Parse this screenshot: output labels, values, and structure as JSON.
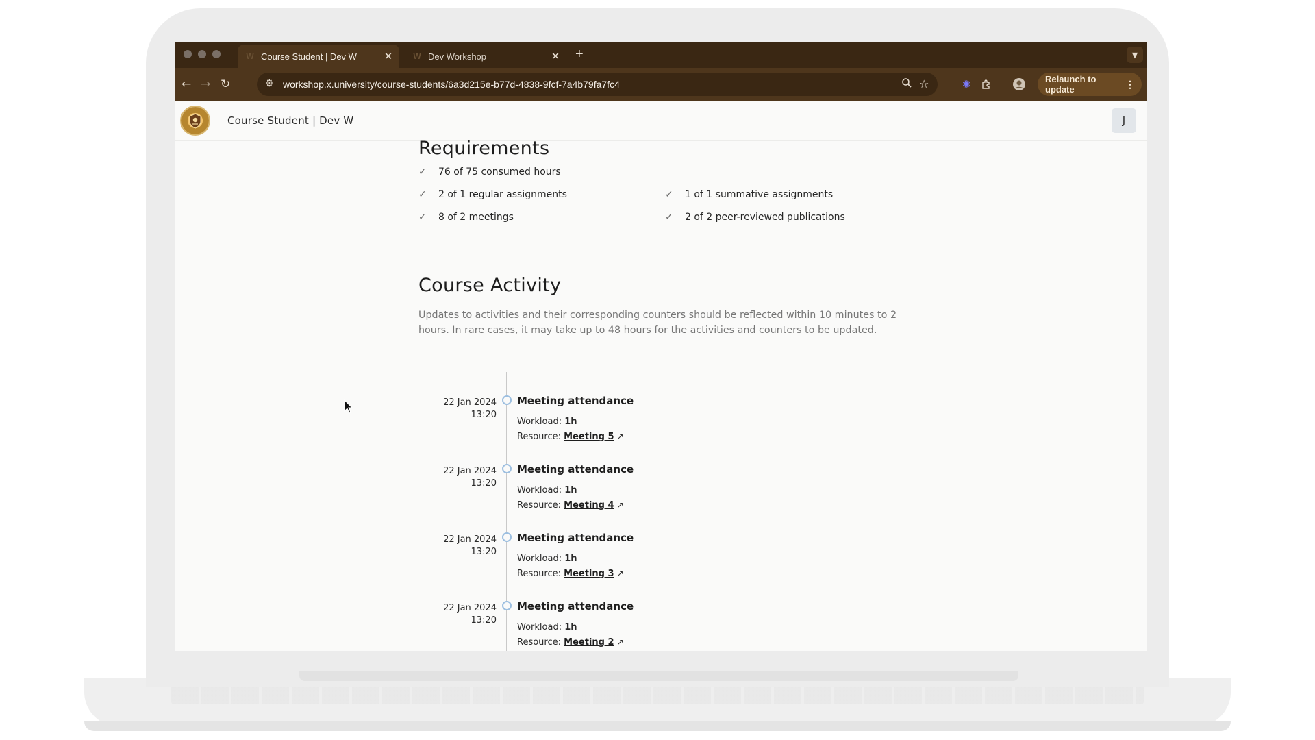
{
  "browser": {
    "tabs": [
      {
        "favicon": "W",
        "title": "Course Student | Dev W",
        "active": true
      },
      {
        "favicon": "W",
        "title": "Dev Workshop",
        "active": false
      }
    ],
    "new_tab_label": "+",
    "url": "workshop.x.university/course-students/6a3d215e-b77d-4838-9fcf-7a4b79fa7fc4",
    "relaunch_label": "Relaunch to update"
  },
  "app": {
    "title": "Course Student | Dev W",
    "avatar_initial": "J"
  },
  "requirements": {
    "title": "Requirements",
    "items": [
      "76 of 75 consumed hours",
      "2 of 1 regular assignments",
      "1 of 1 summative assignments",
      "8 of 2 meetings",
      "2 of 2 peer-reviewed publications"
    ]
  },
  "activity": {
    "title": "Course Activity",
    "description": "Updates to activities and their corresponding counters should be reflected within 10 minutes to 2 hours. In rare cases, it may take up to 48 hours for the activities and counters to be updated.",
    "workload_label": "Workload:",
    "resource_label": "Resource:",
    "entries": [
      {
        "date": "22 Jan 2024",
        "time": "13:20",
        "title": "Meeting attendance",
        "workload": "1h",
        "resource": "Meeting 5"
      },
      {
        "date": "22 Jan 2024",
        "time": "13:20",
        "title": "Meeting attendance",
        "workload": "1h",
        "resource": "Meeting 4"
      },
      {
        "date": "22 Jan 2024",
        "time": "13:20",
        "title": "Meeting attendance",
        "workload": "1h",
        "resource": "Meeting 3"
      },
      {
        "date": "22 Jan 2024",
        "time": "13:20",
        "title": "Meeting attendance",
        "workload": "1h",
        "resource": "Meeting 2"
      }
    ]
  },
  "icons": {
    "back": "arrow-left-icon",
    "forward": "arrow-right-icon",
    "reload": "reload-icon",
    "site_settings": "tune-icon",
    "zoom": "zoom-icon",
    "bookmark": "star-icon",
    "check": "check-icon",
    "external": "external-link-icon"
  },
  "colors": {
    "browser_frame": "#3a2713",
    "browser_toolbar": "#4e361c",
    "timeline_dot": "#9dbfe0"
  }
}
